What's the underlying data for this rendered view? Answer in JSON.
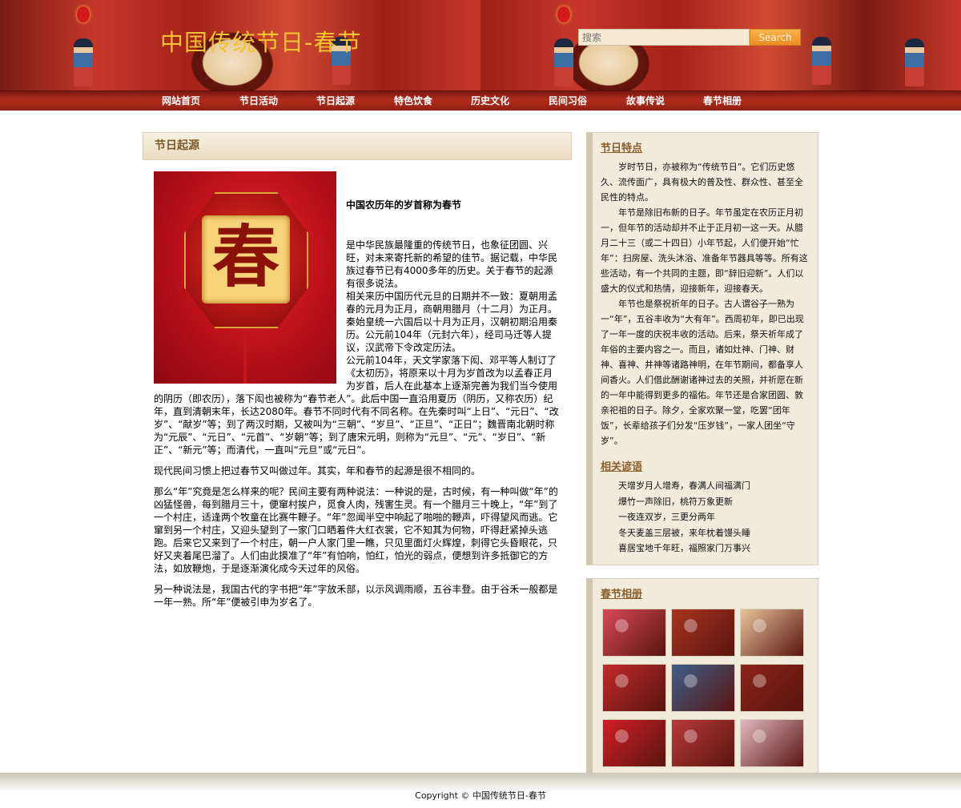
{
  "header": {
    "title": "中国传统节日-春节",
    "search_placeholder": "搜索",
    "search_button": "Search"
  },
  "nav": [
    "网站首页",
    "节日活动",
    "节日起源",
    "特色饮食",
    "历史文化",
    "民间习俗",
    "故事传说",
    "春节相册"
  ],
  "main": {
    "heading": "节日起源",
    "image_label": "春",
    "subtitle": "中国农历年的岁首称为春节",
    "paragraphs": [
      "是中华民族最隆重的传统节日，也象征团圆、兴旺，对未来寄托新的希望的佳节。据记载，中华民族过春节已有4000多年的历史。关于春节的起源有很多说法。",
      "相关来历中国历代元旦的日期并不一致：夏朝用孟春的元月为正月，商朝用腊月（十二月）为正月。秦始皇统一六国后以十月为正月，汉朝初期沿用秦历。公元前104年（元封六年），经司马迁等人提议，汉武帝下令改定历法。",
      "公元前104年，天文学家落下闳、邓平等人制订了《太初历》，将原来以十月为岁首改为以孟春正月为岁首，后人在此基本上逐渐完善为我们当今使用的阴历（即农历），落下闳也被称为“春节老人”。此后中国一直沿用夏历（阴历，又称农历）纪年，直到清朝末年，长达2080年。春节不同时代有不同名称。在先秦时叫“上日”、“元日”、“改岁”、“献岁”等；到了两汉时期，又被叫为“三朝”、“岁旦”、“正旦”、“正日”；魏晋南北朝时称为“元辰”、“元日”、“元首”、“岁朝”等；到了唐宋元明，则称为“元旦”、“元”、“岁日”、“新正”、“新元”等；而清代，一直叫“元旦”或“元日”。",
      "现代民间习惯上把过春节又叫做过年。其实，年和春节的起源是很不相同的。",
      "那么“年”究竟是怎么样来的呢？民间主要有两种说法：一种说的是，古时候，有一种叫做“年”的凶猛怪兽，每到腊月三十，便窜村挨户，觅食人肉，残害生灵。有一个腊月三十晚上，“年”到了一个村庄，适逢两个牧童在比赛牛鞭子。“年”忽闻半空中响起了啪啪的鞭声，吓得望风而逃。它窜到另一个村庄，又迎头望到了一家门口晒着件大红衣裳，它不知其为何物，吓得赶紧掉头逃跑。后来它又来到了一个村庄，朝一户人家门里一瞧，只见里面灯火辉煌，刺得它头昏眼花，只好又夹着尾巴溜了。人们由此摸准了“年”有怕响，怕红，怕光的弱点，便想到许多抵御它的方法，如放鞭炮，于是逐渐演化成今天过年的风俗。",
      "另一种说法是，我国古代的字书把“年”字放禾部，以示风调雨顺，五谷丰登。由于谷禾一般都是一年一熟。所“年”便被引申为岁名了。"
    ]
  },
  "sidebar": {
    "features_heading": "节日特点",
    "features": [
      "岁时节日，亦被称为“传统节日”。它们历史悠久、流传面广，具有极大的普及性、群众性、甚至全民性的特点。",
      "年节是除旧布新的日子。年节虽定在农历正月初一，但年节的活动却并不止于正月初一这一天。从腊月二十三（或二十四日）小年节起，人们便开始“忙年”：扫房屋、洗头沐浴、准备年节器具等等。所有这些活动，有一个共同的主题，即“辞旧迎新”。人们以盛大的仪式和热情，迎接新年，迎接春天。",
      "年节也是祭祝祈年的日子。古人谓谷子一熟为一“年”，五谷丰收为“大有年”。西周初年，即已出现了一年一度的庆祝丰收的活动。后来，祭天祈年成了年俗的主要内容之一。而且，诸如灶神、门神、财神、喜神、井神等诸路神明，在年节期间，都备享人间香火。人们借此酬谢诸神过去的关照，并祈愿在新的一年中能得到更多的福佑。年节还是合家团圆、敦亲祀祖的日子。除夕，全家欢聚一堂，吃罢“团年饭”，长辈给孩子们分发“压岁钱”，一家人团坐“守岁”。"
    ],
    "idioms_heading": "相关谚语",
    "idioms": [
      "天增岁月人增寿，春满人间福满门",
      "爆竹一声除旧，桃符万象更新",
      "一夜连双岁，三更分两年",
      "冬天麦盖三层被，来年枕着馒头睡",
      "喜居宝地千年旺，福照家门万事兴"
    ],
    "gallery_heading": "春节相册",
    "gallery_colors": [
      "#d9485a",
      "#a8341f",
      "#e8c49a",
      "#c22a2a",
      "#3c5f8a",
      "#8b2418",
      "#d21f25",
      "#b83a3a",
      "#e0b8c0"
    ]
  },
  "footer": {
    "copyright": "Copyright © 中国传统节日-春节"
  }
}
